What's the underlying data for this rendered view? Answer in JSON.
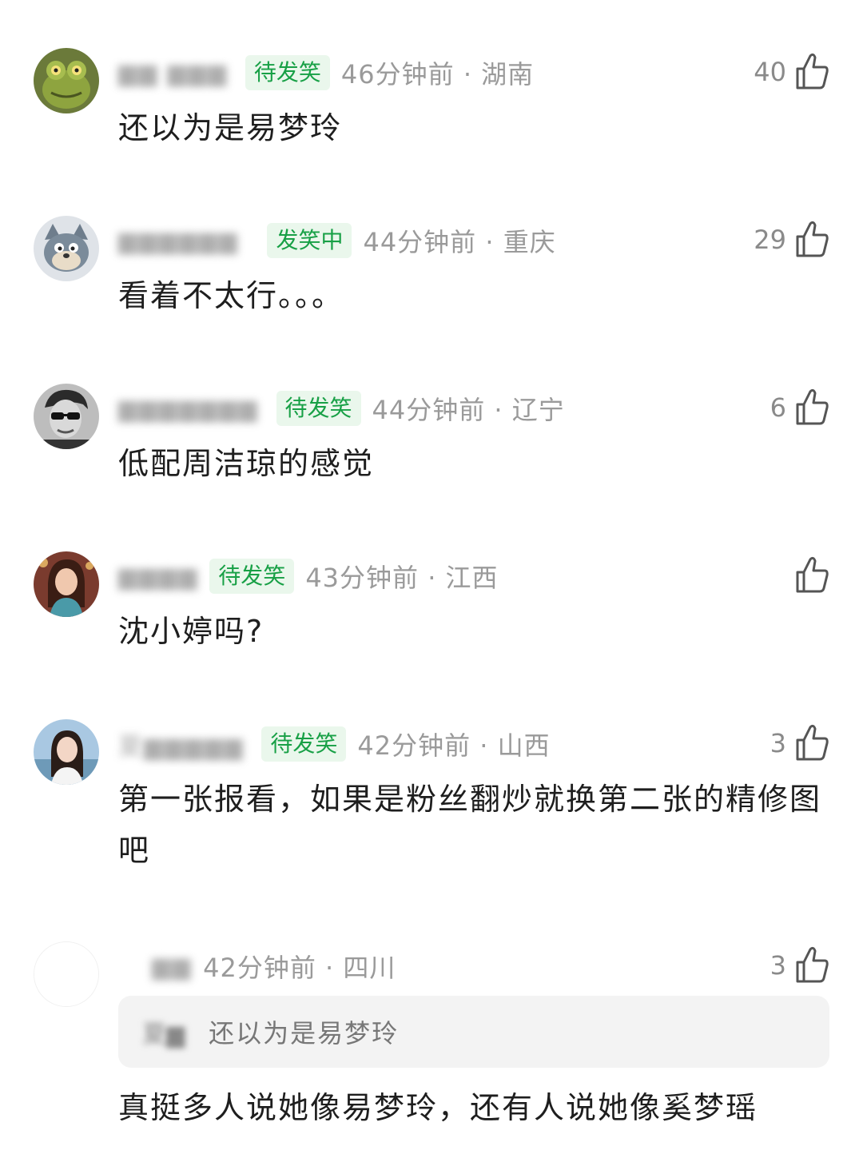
{
  "comments": [
    {
      "username": "▆▆ ▆▆▆",
      "badge": "待发笑",
      "meta": "46分钟前 · 湖南",
      "likes": "40",
      "text": "还以为是易梦玲",
      "avatar": "frog-avatar-icon"
    },
    {
      "username": "▆▆▆▆▆▆",
      "badge": "发笑中",
      "meta": "44分钟前 · 重庆",
      "likes": "29",
      "text": "看着不太行。。。",
      "avatar": "cartoon-cat-avatar-icon"
    },
    {
      "username": "▆▆▆▆▆▆▆",
      "badge": "待发笑",
      "meta": "44分钟前 · 辽宁",
      "likes": "6",
      "text": "低配周洁琼的感觉",
      "avatar": "man-sunglasses-avatar-icon"
    },
    {
      "username": "▆▆▆▆",
      "badge": "待发笑",
      "meta": "43分钟前 · 江西",
      "likes": "",
      "text": "沈小婷吗?",
      "avatar": "woman-portrait-avatar-icon"
    },
    {
      "username": "夏▆▆▆▆▆",
      "badge": "待发笑",
      "meta": "42分钟前 · 山西",
      "likes": "3",
      "text": "第一张报看，如果是粉丝翻炒就换第二张的精修图吧",
      "avatar": "woman-seaside-avatar-icon"
    },
    {
      "username": "▆▆",
      "badge": "",
      "meta": "42分钟前 · 四川",
      "likes": "3",
      "quote_user": "夏▆",
      "quote_text": "还以为是易梦玲",
      "text": "真挺多人说她像易梦玲，还有人说她像奚梦瑶",
      "avatar": "blank-avatar-icon"
    }
  ],
  "colors": {
    "badge_bg": "#eaf7ec",
    "badge_text": "#18a046",
    "meta_text": "#9a9a9a",
    "body_text": "#1e1e1e",
    "quote_bg": "#f3f3f3"
  },
  "icons": {
    "like": "thumbs-up-outline-icon"
  }
}
